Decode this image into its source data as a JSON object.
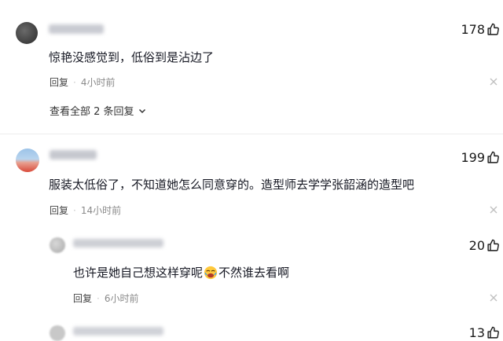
{
  "comments": [
    {
      "text": "惊艳没感觉到，低俗到是沾边了",
      "reply_label": "回复",
      "time": "4小时前",
      "likes": "178",
      "view_all": "查看全部 2 条回复"
    },
    {
      "text": "服装太低俗了，不知道她怎么同意穿的。造型师去学学张韶涵的造型吧",
      "reply_label": "回复",
      "time": "14小时前",
      "likes": "199"
    }
  ],
  "replies": [
    {
      "text_before": "也许是她自己想这样穿呢",
      "emoji": "emoji-face-icon",
      "text_after": "不然谁去看啊",
      "reply_label": "回复",
      "time": "6小时前",
      "likes": "20"
    }
  ],
  "partial": {
    "likes": "13"
  },
  "colors": {
    "like_icon": "#1a1a1a",
    "meta": "#8a8a8a",
    "divider": "#ececec"
  },
  "icons": {
    "like": "thumb-up-icon",
    "close": "close-icon",
    "chevron": "chevron-down-icon"
  }
}
